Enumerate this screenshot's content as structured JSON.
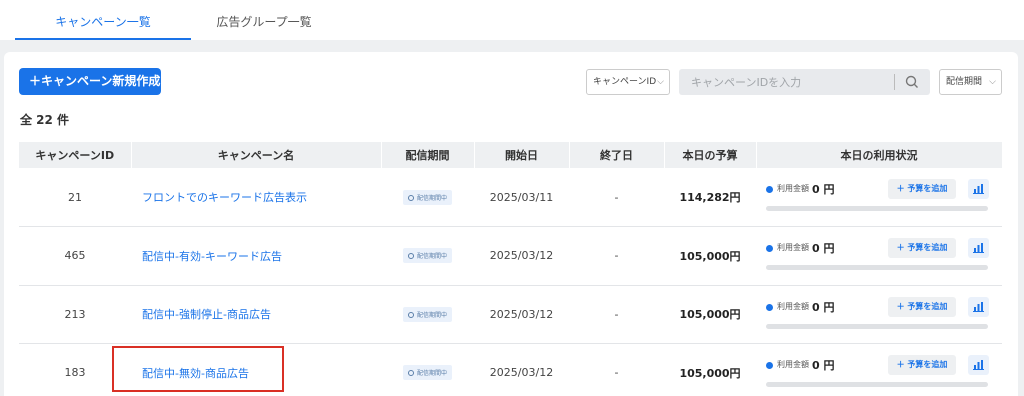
{
  "tabs": [
    {
      "label": "キャンペーン一覧",
      "active": true
    },
    {
      "label": "広告グループ一覧",
      "active": false
    }
  ],
  "toolbar": {
    "create_label": "＋キャンペーン新規作成",
    "filter_select": "キャンペーンID",
    "search_placeholder": "キャンペーンIDを入力",
    "period_select": "配信期間"
  },
  "count_label": "全 22 件",
  "table": {
    "headers": [
      "キャンペーンID",
      "キャンペーン名",
      "配信期間",
      "開始日",
      "終了日",
      "本日の予算",
      "本日の利用状況"
    ],
    "rows": [
      {
        "id": "21",
        "name": "フロントでのキーワード広告表示",
        "period": "配信期間中",
        "start": "2025/03/11",
        "end": "-",
        "budget": "114,282円",
        "usage_label": "利用金額",
        "usage_value": "0 円",
        "add_label": "＋ 予算を追加",
        "progress": 0
      },
      {
        "id": "465",
        "name": "配信中-有効-キーワード広告",
        "period": "配信期間中",
        "start": "2025/03/12",
        "end": "-",
        "budget": "105,000円",
        "usage_label": "利用金額",
        "usage_value": "0 円",
        "add_label": "＋ 予算を追加",
        "progress": 0
      },
      {
        "id": "213",
        "name": "配信中-強制停止-商品広告",
        "period": "配信期間中",
        "start": "2025/03/12",
        "end": "-",
        "budget": "105,000円",
        "usage_label": "利用金額",
        "usage_value": "0 円",
        "add_label": "＋ 予算を追加",
        "progress": 0
      },
      {
        "id": "183",
        "name": "配信中-無効-商品広告",
        "period": "配信期間中",
        "start": "2025/03/12",
        "end": "-",
        "budget": "105,000円",
        "usage_label": "利用金額",
        "usage_value": "0 円",
        "add_label": "＋ 予算を追加",
        "progress": 0
      }
    ]
  },
  "colors": {
    "accent": "#1a73e8",
    "highlight": "#d93025"
  },
  "icons": {
    "search": "search-icon",
    "chart": "bar-chart-icon",
    "dropdown": "chevron-down-icon",
    "clock": "clock-icon"
  }
}
